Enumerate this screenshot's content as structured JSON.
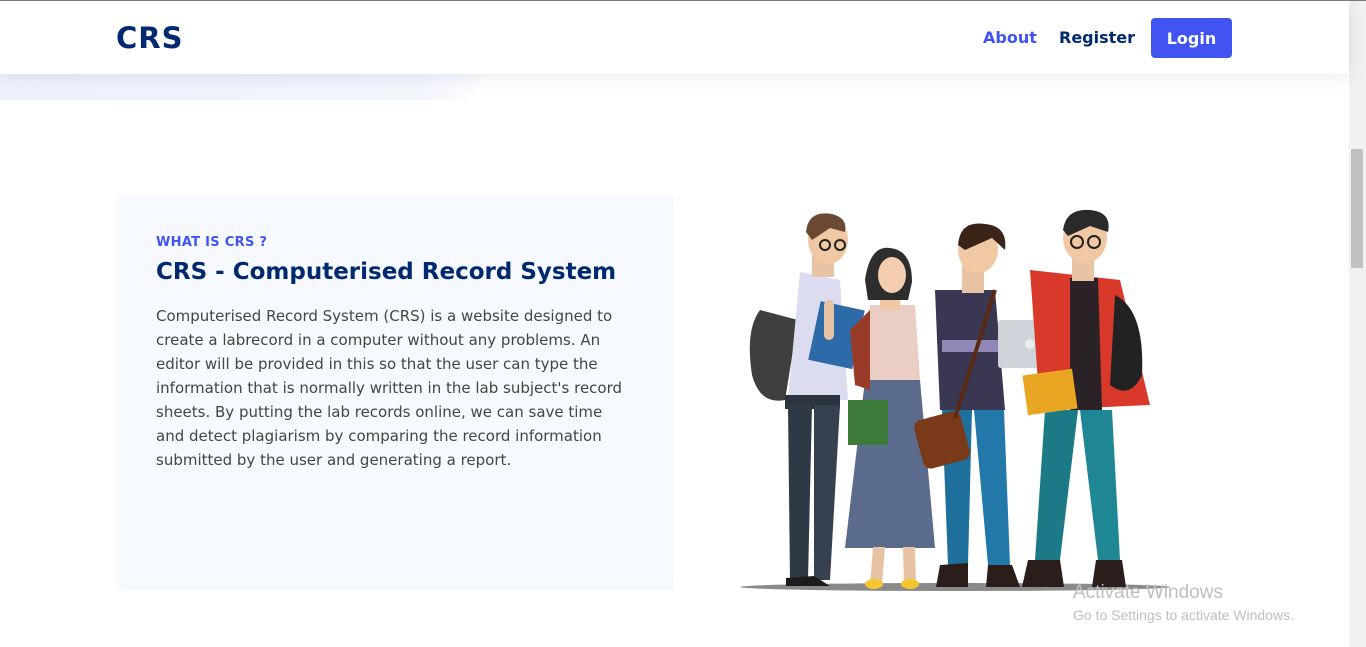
{
  "header": {
    "logo": "CRS",
    "nav": {
      "about": "About",
      "register": "Register",
      "login": "Login"
    }
  },
  "about": {
    "eyebrow": "WHAT IS CRS ?",
    "title": "CRS - Computerised Record System",
    "description": "Computerised Record System (CRS) is a website designed to create a labrecord in a computer without any problems. An editor will be provided in this so that the user can type the information that is normally written in the lab subject's record sheets. By putting the lab records online, we can save time and detect plagiarism by comparing the record information submitted by the user and generating a report."
  },
  "watermark": {
    "title": "Activate Windows",
    "subtitle": "Go to Settings to activate Windows."
  },
  "colors": {
    "brand": "#012970",
    "accent": "#4154f1",
    "card_bg": "#f6f9ff"
  }
}
